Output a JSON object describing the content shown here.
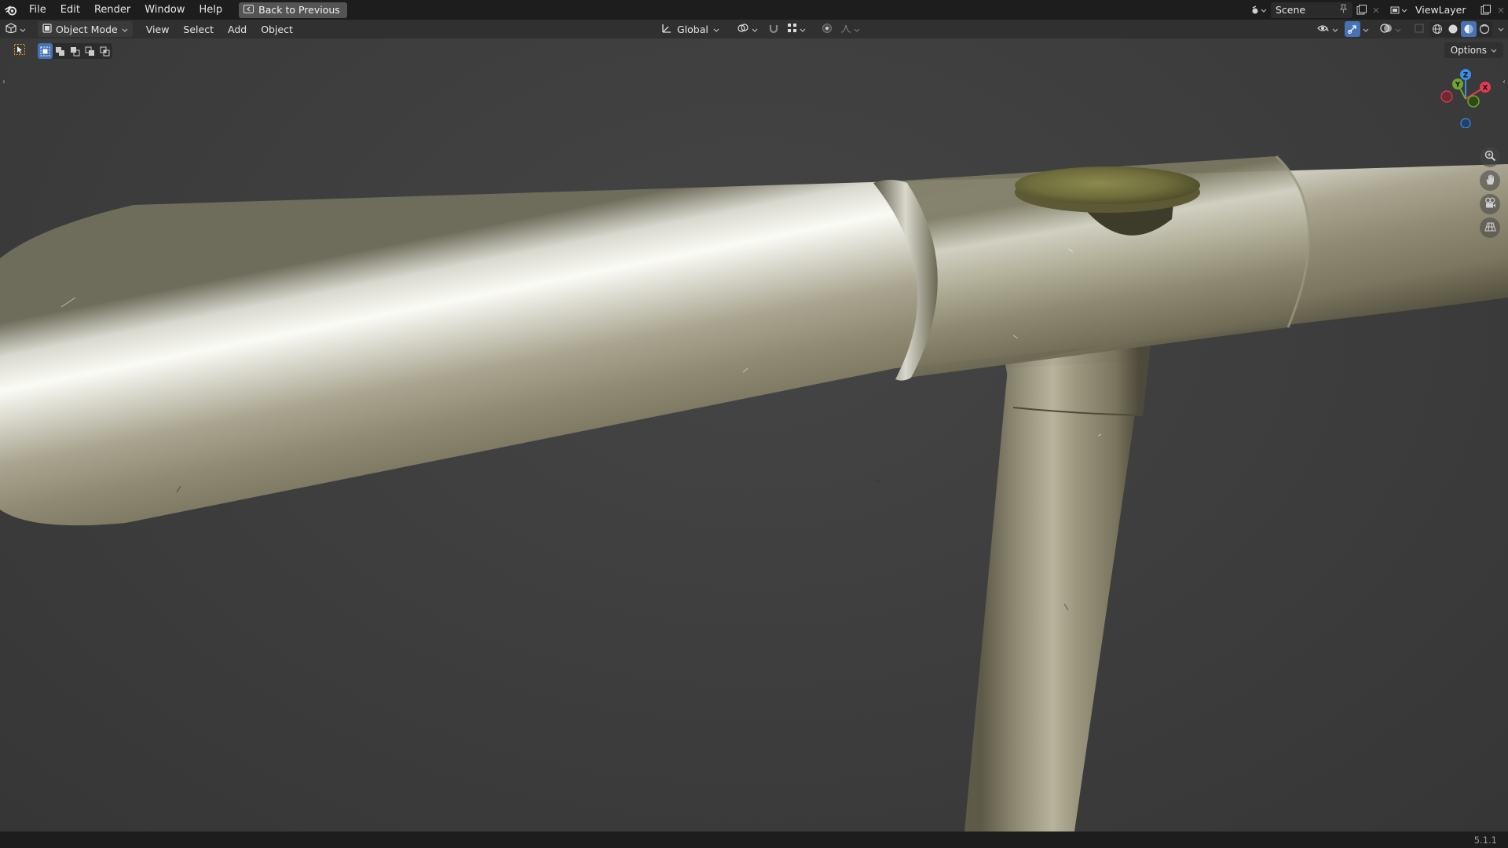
{
  "menubar": {
    "items": [
      {
        "id": "file",
        "label": "File"
      },
      {
        "id": "edit",
        "label": "Edit"
      },
      {
        "id": "render",
        "label": "Render"
      },
      {
        "id": "window",
        "label": "Window"
      },
      {
        "id": "help",
        "label": "Help"
      }
    ],
    "back_button": "Back to Previous",
    "scene_name": "Scene",
    "view_layer_name": "ViewLayer"
  },
  "viewport_header": {
    "mode": "Object Mode",
    "menus": [
      {
        "id": "view",
        "label": "View"
      },
      {
        "id": "select",
        "label": "Select"
      },
      {
        "id": "add",
        "label": "Add"
      },
      {
        "id": "object",
        "label": "Object"
      }
    ],
    "transform_orientation": "Global",
    "options_label": "Options"
  },
  "gizmo": {
    "x_label": "X",
    "y_label": "Y",
    "z_label": "Z",
    "colors": {
      "x": "#e63a4f",
      "y": "#6fa62d",
      "z": "#3d8fe6"
    }
  },
  "theme": {
    "accent": "#4772b3",
    "header_bg": "#303030",
    "topbar_bg": "#1d1d1d",
    "viewport_bg": "#3d3d3d"
  },
  "statusbar": {
    "version": "5.1.1"
  }
}
